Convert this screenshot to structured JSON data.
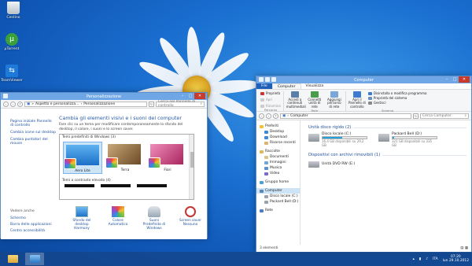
{
  "desktop": {
    "icons": [
      {
        "label": "Cestino",
        "color": "#d7dde4"
      },
      {
        "label": "µTorrent",
        "color": "#3aa13a"
      },
      {
        "label": "TeamViewer",
        "color": "#1e7ad8"
      }
    ]
  },
  "personalize": {
    "title": "Personalizzazione",
    "address": [
      "Aspetto e personalizza...",
      "Personalizzazione"
    ],
    "search_placeholder": "Cerca nel Pannello di controllo",
    "sidebar": [
      "Pagina iniziale Pannello di controllo",
      "Cambia icone sul desktop",
      "Cambia puntatori del mouse"
    ],
    "see_also_label": "Vedere anche",
    "see_also": [
      "Schermo",
      "Barra delle applicazioni",
      "Centro accessibilità"
    ],
    "heading": "Cambia gli elementi visivi e i suoni del computer",
    "description": "Fare clic su un tema per modificare contemporaneamente lo sfondo del desktop, il colore, i suoni e lo screen saver.",
    "group_label": "Temi predefiniti di Windows (3)",
    "themes": [
      {
        "label": "Aero Lite",
        "bg": "#2f86d8"
      },
      {
        "label": "Terra",
        "bg": "#8e6a3f"
      },
      {
        "label": "Fiori",
        "bg": "#c23a7a"
      }
    ],
    "high_contrast_label": "Temi a contrasto elevato (4)",
    "bottom": [
      {
        "label": "Sfondo del desktop",
        "sub": "Harmony",
        "color": "#2d87dd"
      },
      {
        "label": "Colore",
        "sub": "Automatico",
        "color": "#52a7e8"
      },
      {
        "label": "Suoni",
        "sub": "Predefinito di Windows",
        "color": "#9aa7b5"
      },
      {
        "label": "Screen saver",
        "sub": "Nessuno",
        "color": "#c83232"
      }
    ]
  },
  "computer": {
    "title": "Computer",
    "tabs": [
      "File",
      "Computer",
      "Visualizza"
    ],
    "ribbon": {
      "location": {
        "name": "Percorso",
        "items": [
          "Proprietà",
          "Apri",
          "Rinomina"
        ]
      },
      "network": {
        "name": "Rete",
        "items": [
          "Accedi a contenuti multimediali",
          "Connetti unità di rete",
          "Aggiungi percorso di rete"
        ]
      },
      "system_big": "Apri il Pannello di controllo",
      "system": {
        "name": "Sistema",
        "items": [
          "Disinstalla o modifica programma",
          "Proprietà del sistema",
          "Gestisci"
        ]
      }
    },
    "address": "Computer",
    "search_placeholder": "Cerca Computer",
    "nav": {
      "favorites": {
        "label": "Preferiti",
        "items": [
          "Desktop",
          "Download",
          "Risorse recenti"
        ]
      },
      "libraries": {
        "label": "Raccolte",
        "items": [
          "Documenti",
          "Immagini",
          "Musica",
          "Video"
        ]
      },
      "homegroup": "Gruppo home",
      "computer": {
        "label": "Computer",
        "items": [
          "Disco locale (C:)",
          "Packard Bell (D:)"
        ]
      },
      "network": "Rete"
    },
    "hard_disks_label": "Unità disco rigido (2)",
    "drives": [
      {
        "name": "Disco locale (C:)",
        "free": "16,4 GB disponibili su 29,2 GB",
        "used_fraction": 0.44
      },
      {
        "name": "Packard Bell (D:)",
        "free": "321 GB disponibili su 335 GB",
        "used_fraction": 0.04
      }
    ],
    "removable_label": "Dispositivi con archivi rimovibili (1)",
    "dvd": "Unità DVD RW (E:)",
    "status": "3 elementi"
  },
  "taskbar": {
    "language": "ITA",
    "time": "07:20",
    "date": "lun 29.10.2012"
  }
}
